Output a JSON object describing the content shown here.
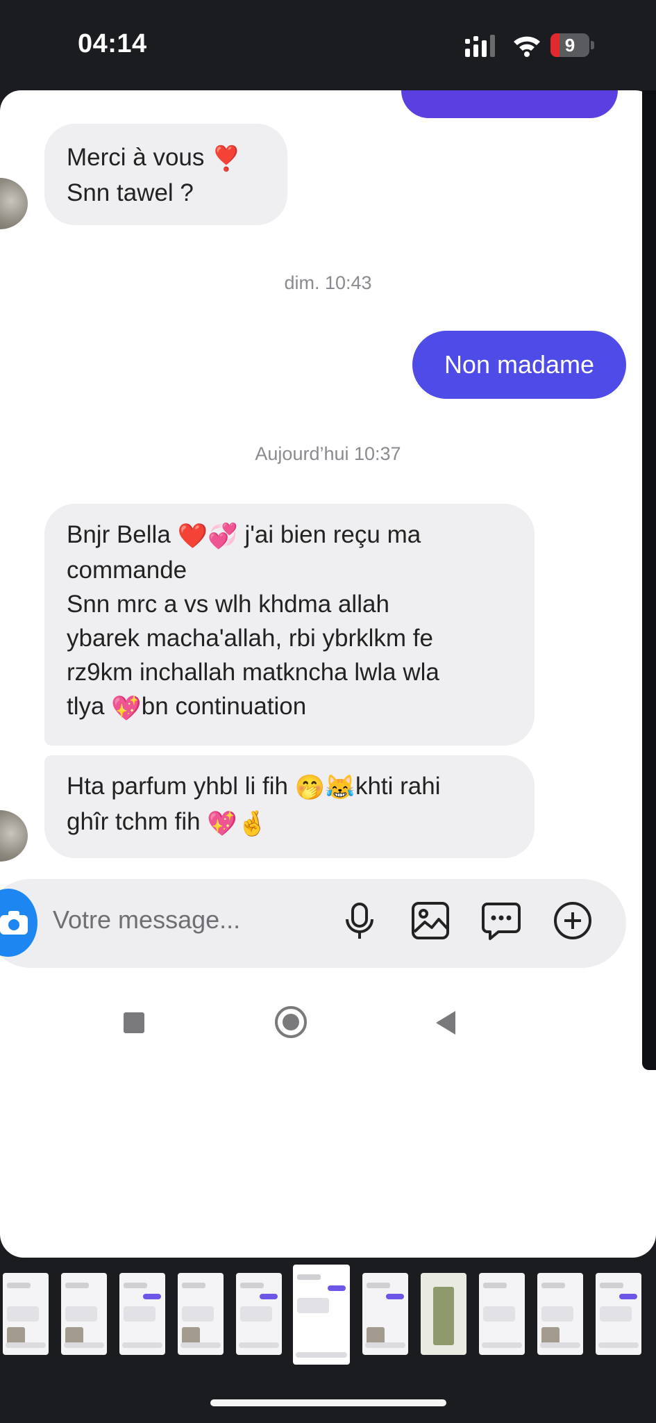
{
  "status_bar": {
    "time": "04:14",
    "battery_level": "9",
    "battery_fraction": 0.09,
    "accent_battery": "#e3292e"
  },
  "conversation": {
    "received_1": {
      "line1": "Merci à vous",
      "line1_emoji": "❣️",
      "line2": "Snn tawel ?"
    },
    "timestamp_1": "dim. 10:43",
    "sent_1": "Non madame",
    "timestamp_2": "Aujourd’hui 10:37",
    "received_2": {
      "l1a": "Bnjr Bella",
      "l1_emoji": "❤️💞",
      "l1b": "j'ai bien reçu ma",
      "l2": "commande",
      "l3": "Snn mrc a vs wlh khdma allah",
      "l4": "ybarek macha'allah, rbi ybrklkm fe",
      "l5": "rz9km inchallah matkncha lwla wla",
      "l6a": "tlya",
      "l6_emoji": "💖",
      "l6b": "bn continuation"
    },
    "received_3": {
      "l1a": "Hta parfum yhbl li fih",
      "l1_emoji": "🤭😹",
      "l1b": "khti rahi",
      "l2a": "ghîr tchm fih",
      "l2_emoji": "💖🤞"
    },
    "colors": {
      "sent_bubble": "#4f4be6",
      "received_bubble": "#efeff1"
    }
  },
  "composer": {
    "placeholder": "Votre message...",
    "icons": [
      "camera-icon",
      "microphone-icon",
      "image-icon",
      "chat-more-icon",
      "plus-icon"
    ]
  },
  "navigation": {
    "icons": [
      "recents-icon",
      "home-icon",
      "back-icon"
    ]
  }
}
